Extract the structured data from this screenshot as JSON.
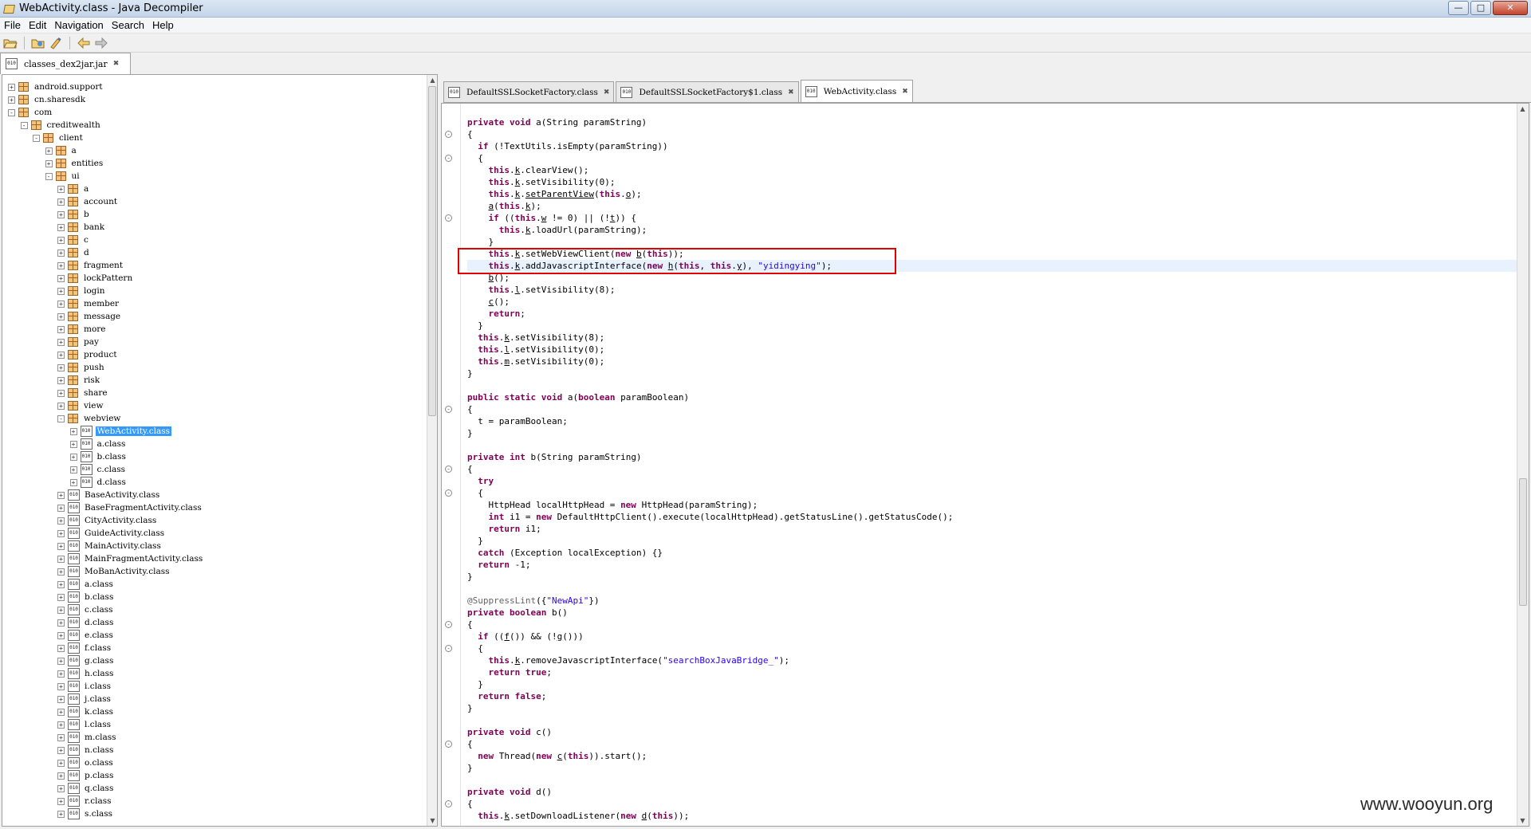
{
  "window": {
    "title": "WebActivity.class - Java Decompiler"
  },
  "menu": [
    "File",
    "Edit",
    "Navigation",
    "Search",
    "Help"
  ],
  "toolbar": {
    "icons": [
      "open-file-icon",
      "open-type-icon",
      "search-icon",
      "back-icon",
      "forward-icon"
    ]
  },
  "left_tab": {
    "label": "classes_dex2jar.jar"
  },
  "tree": [
    {
      "label": "android.support",
      "depth": 0,
      "type": "pkg",
      "toggle": "+"
    },
    {
      "label": "cn.sharesdk",
      "depth": 0,
      "type": "pkg",
      "toggle": "+"
    },
    {
      "label": "com",
      "depth": 0,
      "type": "pkg",
      "toggle": "-"
    },
    {
      "label": "creditwealth",
      "depth": 1,
      "type": "pkg",
      "toggle": "-"
    },
    {
      "label": "client",
      "depth": 2,
      "type": "pkg",
      "toggle": "-"
    },
    {
      "label": "a",
      "depth": 3,
      "type": "pkg",
      "toggle": "+"
    },
    {
      "label": "entities",
      "depth": 3,
      "type": "pkg",
      "toggle": "+"
    },
    {
      "label": "ui",
      "depth": 3,
      "type": "pkg",
      "toggle": "-"
    },
    {
      "label": "a",
      "depth": 4,
      "type": "pkg",
      "toggle": "+"
    },
    {
      "label": "account",
      "depth": 4,
      "type": "pkg",
      "toggle": "+"
    },
    {
      "label": "b",
      "depth": 4,
      "type": "pkg",
      "toggle": "+"
    },
    {
      "label": "bank",
      "depth": 4,
      "type": "pkg",
      "toggle": "+"
    },
    {
      "label": "c",
      "depth": 4,
      "type": "pkg",
      "toggle": "+"
    },
    {
      "label": "d",
      "depth": 4,
      "type": "pkg",
      "toggle": "+"
    },
    {
      "label": "fragment",
      "depth": 4,
      "type": "pkg",
      "toggle": "+"
    },
    {
      "label": "lockPattern",
      "depth": 4,
      "type": "pkg",
      "toggle": "+"
    },
    {
      "label": "login",
      "depth": 4,
      "type": "pkg",
      "toggle": "+"
    },
    {
      "label": "member",
      "depth": 4,
      "type": "pkg",
      "toggle": "+"
    },
    {
      "label": "message",
      "depth": 4,
      "type": "pkg",
      "toggle": "+"
    },
    {
      "label": "more",
      "depth": 4,
      "type": "pkg",
      "toggle": "+"
    },
    {
      "label": "pay",
      "depth": 4,
      "type": "pkg",
      "toggle": "+"
    },
    {
      "label": "product",
      "depth": 4,
      "type": "pkg",
      "toggle": "+"
    },
    {
      "label": "push",
      "depth": 4,
      "type": "pkg",
      "toggle": "+"
    },
    {
      "label": "risk",
      "depth": 4,
      "type": "pkg",
      "toggle": "+"
    },
    {
      "label": "share",
      "depth": 4,
      "type": "pkg",
      "toggle": "+"
    },
    {
      "label": "view",
      "depth": 4,
      "type": "pkg",
      "toggle": "+"
    },
    {
      "label": "webview",
      "depth": 4,
      "type": "pkg",
      "toggle": "-"
    },
    {
      "label": "WebActivity.class",
      "depth": 5,
      "type": "class",
      "toggle": "+",
      "selected": true
    },
    {
      "label": "a.class",
      "depth": 5,
      "type": "class",
      "toggle": "+"
    },
    {
      "label": "b.class",
      "depth": 5,
      "type": "class",
      "toggle": "+"
    },
    {
      "label": "c.class",
      "depth": 5,
      "type": "class",
      "toggle": "+"
    },
    {
      "label": "d.class",
      "depth": 5,
      "type": "class",
      "toggle": "+"
    },
    {
      "label": "BaseActivity.class",
      "depth": 4,
      "type": "class",
      "toggle": "+"
    },
    {
      "label": "BaseFragmentActivity.class",
      "depth": 4,
      "type": "class",
      "toggle": "+"
    },
    {
      "label": "CityActivity.class",
      "depth": 4,
      "type": "class",
      "toggle": "+"
    },
    {
      "label": "GuideActivity.class",
      "depth": 4,
      "type": "class",
      "toggle": "+"
    },
    {
      "label": "MainActivity.class",
      "depth": 4,
      "type": "class",
      "toggle": "+"
    },
    {
      "label": "MainFragmentActivity.class",
      "depth": 4,
      "type": "class",
      "toggle": "+"
    },
    {
      "label": "MoBanActivity.class",
      "depth": 4,
      "type": "class",
      "toggle": "+"
    },
    {
      "label": "a.class",
      "depth": 4,
      "type": "class",
      "toggle": "+"
    },
    {
      "label": "b.class",
      "depth": 4,
      "type": "class",
      "toggle": "+"
    },
    {
      "label": "c.class",
      "depth": 4,
      "type": "class",
      "toggle": "+"
    },
    {
      "label": "d.class",
      "depth": 4,
      "type": "class",
      "toggle": "+"
    },
    {
      "label": "e.class",
      "depth": 4,
      "type": "class",
      "toggle": "+"
    },
    {
      "label": "f.class",
      "depth": 4,
      "type": "class",
      "toggle": "+"
    },
    {
      "label": "g.class",
      "depth": 4,
      "type": "class",
      "toggle": "+"
    },
    {
      "label": "h.class",
      "depth": 4,
      "type": "class",
      "toggle": "+"
    },
    {
      "label": "i.class",
      "depth": 4,
      "type": "class",
      "toggle": "+"
    },
    {
      "label": "j.class",
      "depth": 4,
      "type": "class",
      "toggle": "+"
    },
    {
      "label": "k.class",
      "depth": 4,
      "type": "class",
      "toggle": "+"
    },
    {
      "label": "l.class",
      "depth": 4,
      "type": "class",
      "toggle": "+"
    },
    {
      "label": "m.class",
      "depth": 4,
      "type": "class",
      "toggle": "+"
    },
    {
      "label": "n.class",
      "depth": 4,
      "type": "class",
      "toggle": "+"
    },
    {
      "label": "o.class",
      "depth": 4,
      "type": "class",
      "toggle": "+"
    },
    {
      "label": "p.class",
      "depth": 4,
      "type": "class",
      "toggle": "+"
    },
    {
      "label": "q.class",
      "depth": 4,
      "type": "class",
      "toggle": "+"
    },
    {
      "label": "r.class",
      "depth": 4,
      "type": "class",
      "toggle": "+"
    },
    {
      "label": "s.class",
      "depth": 4,
      "type": "class",
      "toggle": "+"
    }
  ],
  "editor_tabs": [
    {
      "label": "DefaultSSLSocketFactory.class",
      "active": false
    },
    {
      "label": "DefaultSSLSocketFactory$1.class",
      "active": false
    },
    {
      "label": "WebActivity.class",
      "active": true
    }
  ],
  "code": [
    [
      [
        "kw",
        "private void "
      ],
      [
        "",
        "a(String paramString)"
      ]
    ],
    [
      [
        "",
        "{"
      ]
    ],
    [
      [
        "",
        "  "
      ],
      [
        "kw",
        "if "
      ],
      [
        "",
        "(!TextUtils.isEmpty(paramString))"
      ]
    ],
    [
      [
        "",
        "  {"
      ]
    ],
    [
      [
        "",
        "    "
      ],
      [
        "kw",
        "this"
      ],
      [
        "",
        "."
      ],
      [
        "u",
        "k"
      ],
      [
        "",
        ".clearView();"
      ]
    ],
    [
      [
        "",
        "    "
      ],
      [
        "kw",
        "this"
      ],
      [
        "",
        "."
      ],
      [
        "u",
        "k"
      ],
      [
        "",
        ".setVisibility(0);"
      ]
    ],
    [
      [
        "",
        "    "
      ],
      [
        "kw",
        "this"
      ],
      [
        "",
        "."
      ],
      [
        "u",
        "k"
      ],
      [
        "",
        "."
      ],
      [
        "u",
        "setParentView"
      ],
      [
        "",
        "("
      ],
      [
        "kw",
        "this"
      ],
      [
        "",
        "."
      ],
      [
        "u",
        "o"
      ],
      [
        "",
        ");"
      ]
    ],
    [
      [
        "",
        "    "
      ],
      [
        "u",
        "a"
      ],
      [
        "",
        "("
      ],
      [
        "kw",
        "this"
      ],
      [
        "",
        "."
      ],
      [
        "u",
        "k"
      ],
      [
        "",
        ");"
      ]
    ],
    [
      [
        "",
        "    "
      ],
      [
        "kw",
        "if "
      ],
      [
        "",
        "(("
      ],
      [
        "kw",
        "this"
      ],
      [
        "",
        "."
      ],
      [
        "u",
        "w"
      ],
      [
        "",
        " != 0) || (!"
      ],
      [
        "u",
        "t"
      ],
      [
        "",
        ")) {"
      ]
    ],
    [
      [
        "",
        "      "
      ],
      [
        "kw",
        "this"
      ],
      [
        "",
        "."
      ],
      [
        "u",
        "k"
      ],
      [
        "",
        ".loadUrl(paramString);"
      ]
    ],
    [
      [
        "",
        "    }"
      ]
    ],
    [
      [
        "",
        "    "
      ],
      [
        "kw",
        "this"
      ],
      [
        "",
        "."
      ],
      [
        "u",
        "k"
      ],
      [
        "",
        ".setWebViewClient("
      ],
      [
        "kw",
        "new "
      ],
      [
        "u",
        "b"
      ],
      [
        "",
        "("
      ],
      [
        "kw",
        "this"
      ],
      [
        "",
        "));"
      ]
    ],
    [
      [
        "",
        "    "
      ],
      [
        "kw",
        "this"
      ],
      [
        "",
        "."
      ],
      [
        "u",
        "k"
      ],
      [
        "",
        ".addJavascriptInterface("
      ],
      [
        "kw",
        "new "
      ],
      [
        "u",
        "h"
      ],
      [
        "",
        "("
      ],
      [
        "kw",
        "this"
      ],
      [
        "",
        ", "
      ],
      [
        "kw",
        "this"
      ],
      [
        "",
        "."
      ],
      [
        "u",
        "y"
      ],
      [
        "",
        "), "
      ],
      [
        "str",
        "\"yidingying\""
      ],
      [
        "",
        ");"
      ]
    ],
    [
      [
        "",
        "    "
      ],
      [
        "u",
        "b"
      ],
      [
        "",
        "();"
      ]
    ],
    [
      [
        "",
        "    "
      ],
      [
        "kw",
        "this"
      ],
      [
        "",
        "."
      ],
      [
        "u",
        "l"
      ],
      [
        "",
        ".setVisibility(8);"
      ]
    ],
    [
      [
        "",
        "    "
      ],
      [
        "u",
        "c"
      ],
      [
        "",
        "();"
      ]
    ],
    [
      [
        "",
        "    "
      ],
      [
        "kw",
        "return"
      ],
      [
        "",
        ";"
      ]
    ],
    [
      [
        "",
        "  }"
      ]
    ],
    [
      [
        "",
        "  "
      ],
      [
        "kw",
        "this"
      ],
      [
        "",
        "."
      ],
      [
        "u",
        "k"
      ],
      [
        "",
        ".setVisibility(8);"
      ]
    ],
    [
      [
        "",
        "  "
      ],
      [
        "kw",
        "this"
      ],
      [
        "",
        "."
      ],
      [
        "u",
        "l"
      ],
      [
        "",
        ".setVisibility(0);"
      ]
    ],
    [
      [
        "",
        "  "
      ],
      [
        "kw",
        "this"
      ],
      [
        "",
        "."
      ],
      [
        "u",
        "m"
      ],
      [
        "",
        ".setVisibility(0);"
      ]
    ],
    [
      [
        "",
        "}"
      ]
    ],
    [
      [
        "",
        ""
      ]
    ],
    [
      [
        "kw",
        "public static void "
      ],
      [
        "",
        "a("
      ],
      [
        "kw",
        "boolean "
      ],
      [
        "",
        "paramBoolean)"
      ]
    ],
    [
      [
        "",
        "{"
      ]
    ],
    [
      [
        "",
        "  t = paramBoolean;"
      ]
    ],
    [
      [
        "",
        "}"
      ]
    ],
    [
      [
        "",
        ""
      ]
    ],
    [
      [
        "kw",
        "private int "
      ],
      [
        "",
        "b(String paramString)"
      ]
    ],
    [
      [
        "",
        "{"
      ]
    ],
    [
      [
        "",
        "  "
      ],
      [
        "kw",
        "try"
      ]
    ],
    [
      [
        "",
        "  {"
      ]
    ],
    [
      [
        "",
        "    HttpHead localHttpHead = "
      ],
      [
        "kw",
        "new "
      ],
      [
        "",
        "HttpHead(paramString);"
      ]
    ],
    [
      [
        "",
        "    "
      ],
      [
        "kw",
        "int "
      ],
      [
        "",
        "i1 = "
      ],
      [
        "kw",
        "new "
      ],
      [
        "",
        "DefaultHttpClient().execute(localHttpHead).getStatusLine().getStatusCode();"
      ]
    ],
    [
      [
        "",
        "    "
      ],
      [
        "kw",
        "return "
      ],
      [
        "",
        "i1;"
      ]
    ],
    [
      [
        "",
        "  }"
      ]
    ],
    [
      [
        "",
        "  "
      ],
      [
        "kw",
        "catch "
      ],
      [
        "",
        "(Exception localException) {}"
      ]
    ],
    [
      [
        "",
        "  "
      ],
      [
        "kw",
        "return "
      ],
      [
        "",
        "-1;"
      ]
    ],
    [
      [
        "",
        "}"
      ]
    ],
    [
      [
        "",
        ""
      ]
    ],
    [
      [
        "ann",
        "@SuppressLint"
      ],
      [
        "",
        "({"
      ],
      [
        "str",
        "\"NewApi\""
      ],
      [
        "",
        "})"
      ]
    ],
    [
      [
        "kw",
        "private boolean "
      ],
      [
        "",
        "b()"
      ]
    ],
    [
      [
        "",
        "{"
      ]
    ],
    [
      [
        "",
        "  "
      ],
      [
        "kw",
        "if "
      ],
      [
        "",
        "(("
      ],
      [
        "u",
        "f"
      ],
      [
        "",
        "()) && (!"
      ],
      [
        "u",
        "g"
      ],
      [
        "",
        "()))"
      ]
    ],
    [
      [
        "",
        "  {"
      ]
    ],
    [
      [
        "",
        "    "
      ],
      [
        "kw",
        "this"
      ],
      [
        "",
        "."
      ],
      [
        "u",
        "k"
      ],
      [
        "",
        ".removeJavascriptInterface("
      ],
      [
        "str",
        "\"searchBoxJavaBridge_\""
      ],
      [
        "",
        ");"
      ]
    ],
    [
      [
        "",
        "    "
      ],
      [
        "kw",
        "return true"
      ],
      [
        "",
        ";"
      ]
    ],
    [
      [
        "",
        "  }"
      ]
    ],
    [
      [
        "",
        "  "
      ],
      [
        "kw",
        "return false"
      ],
      [
        "",
        ";"
      ]
    ],
    [
      [
        "",
        "}"
      ]
    ],
    [
      [
        "",
        ""
      ]
    ],
    [
      [
        "kw",
        "private void "
      ],
      [
        "",
        "c()"
      ]
    ],
    [
      [
        "",
        "{"
      ]
    ],
    [
      [
        "",
        "  "
      ],
      [
        "kw",
        "new "
      ],
      [
        "",
        "Thread("
      ],
      [
        "kw",
        "new "
      ],
      [
        "u",
        "c"
      ],
      [
        "",
        "("
      ],
      [
        "kw",
        "this"
      ],
      [
        "",
        ")).start();"
      ]
    ],
    [
      [
        "",
        "}"
      ]
    ],
    [
      [
        "",
        ""
      ]
    ],
    [
      [
        "kw",
        "private void "
      ],
      [
        "",
        "d()"
      ]
    ],
    [
      [
        "",
        "{"
      ]
    ],
    [
      [
        "",
        "  "
      ],
      [
        "kw",
        "this"
      ],
      [
        "",
        "."
      ],
      [
        "u",
        "k"
      ],
      [
        "",
        ".setDownloadListener("
      ],
      [
        "kw",
        "new "
      ],
      [
        "u",
        "d"
      ],
      [
        "",
        "("
      ],
      [
        "kw",
        "this"
      ],
      [
        "",
        "));"
      ]
    ]
  ],
  "fold_lines": [
    1,
    3,
    8,
    24,
    29,
    31,
    42,
    44,
    52,
    57
  ],
  "watermark": "www.wooyun.org"
}
